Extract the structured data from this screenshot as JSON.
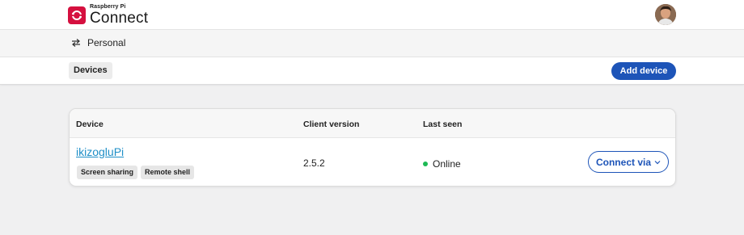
{
  "brand": {
    "small": "Raspberry Pi",
    "big": "Connect",
    "color": "#d5103f"
  },
  "user": {
    "avatar_icon": "user-avatar"
  },
  "org": {
    "name": "Personal",
    "icon": "swap-icon"
  },
  "tabs": [
    {
      "label": "Devices",
      "active": true
    }
  ],
  "actions": {
    "add_device": "Add device",
    "accent": "#1d54b8"
  },
  "table": {
    "headers": {
      "device": "Device",
      "client_version": "Client version",
      "last_seen": "Last seen"
    },
    "rows": [
      {
        "name": "ikizogluPi",
        "tags": [
          "Screen sharing",
          "Remote shell"
        ],
        "client_version": "2.5.2",
        "status": "Online",
        "status_color": "#1db954",
        "action": "Connect via"
      }
    ]
  }
}
